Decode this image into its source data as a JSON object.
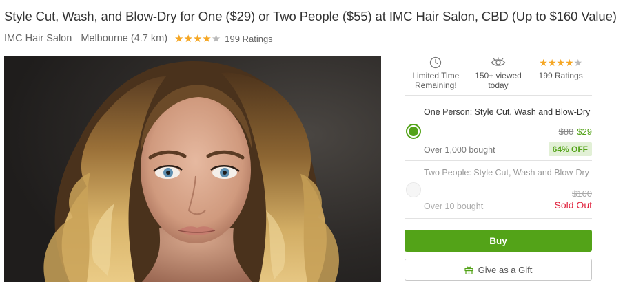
{
  "deal": {
    "title": "Style Cut, Wash, and Blow-Dry for One ($29) or Two People ($55) at IMC Hair Salon, CBD (Up to $160 Value)",
    "merchant": "IMC Hair Salon",
    "location": "Melbourne (4.7 km)",
    "rating_stars": 4.5,
    "ratings_count": "199 Ratings"
  },
  "hero_image": {
    "alt": "woman with long wavy blonde hair",
    "icon": "hero-photo"
  },
  "stats": [
    {
      "icon": "clock-icon",
      "text": "Limited Time Remaining!"
    },
    {
      "icon": "eye-icon",
      "text": "150+ viewed today"
    },
    {
      "icon": "stars-rating",
      "text": "199 Ratings"
    }
  ],
  "options": [
    {
      "title": "One Person: Style Cut, Wash and Blow-Dry",
      "old_price": "$80",
      "new_price": "$29",
      "discount": "64% OFF",
      "bought": "Over 1,000 bought",
      "selected": true
    },
    {
      "title": "Two People: Style Cut, Wash and Blow-Dry",
      "old_price": "$160",
      "status": "Sold Out",
      "bought": "Over 10 bought",
      "selected": false
    }
  ],
  "actions": {
    "buy": "Buy",
    "gift": "Give as a Gift",
    "gift_icon": "gift-icon"
  },
  "colors": {
    "accent_green": "#53a318",
    "discount_bg": "#e2f0d6",
    "sold_out_red": "#e0223d",
    "star_gold": "#f5a623",
    "star_grey": "#b9b9b9"
  }
}
